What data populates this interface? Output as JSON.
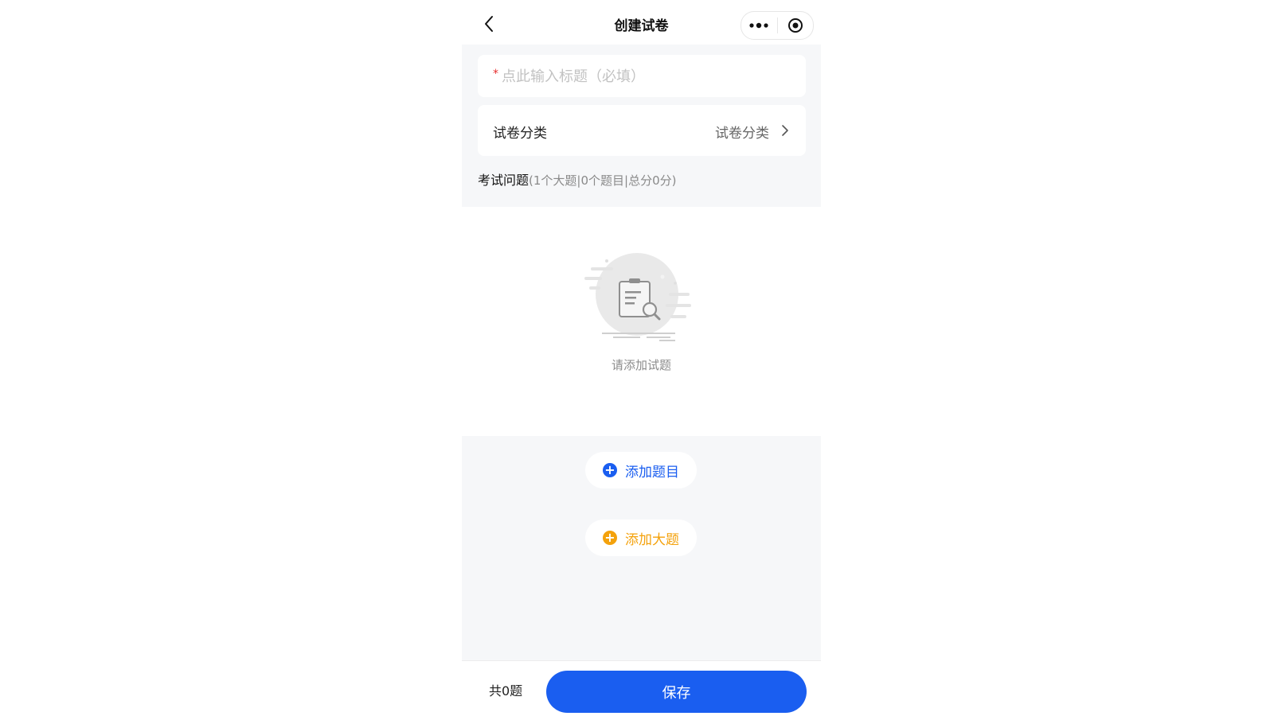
{
  "navbar": {
    "title": "创建试卷",
    "back_icon": "chevron-left-icon",
    "more_icon": "more-dots-icon",
    "close_icon": "target-circle-icon"
  },
  "form": {
    "title_placeholder": "点此输入标题（必填）",
    "required_mark": "*",
    "category_label": "试卷分类",
    "category_value": "试卷分类"
  },
  "questions": {
    "label": "考试问题",
    "stats": "(1个大题|0个题目|总分0分)"
  },
  "empty_state": {
    "text": "请添加试题",
    "icon": "clipboard-search-icon"
  },
  "actions": {
    "add_question": "添加题目",
    "add_section": "添加大题"
  },
  "footer": {
    "total": "共0题",
    "save": "保存"
  },
  "colors": {
    "primary": "#1a5ef0",
    "accent": "#f4a20c",
    "background": "#f6f7f9",
    "required": "#e62e2e"
  }
}
